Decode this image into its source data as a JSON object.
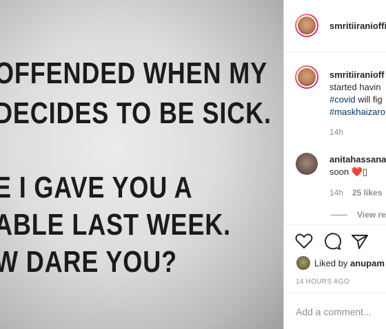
{
  "post_image": {
    "lines": [
      "OFFENDED WHEN MY",
      "DECIDES TO BE SICK.",
      "E I GAVE YOU A",
      "ABLE LAST WEEK.",
      "W DARE YOU?"
    ]
  },
  "header": {
    "username": "smritiiranioffi"
  },
  "caption": {
    "username": "smritiiranioff",
    "line1": "started havin",
    "line2_tag": "#covid",
    "line2_rest": " will fig",
    "line3_tag": "#maskhaizaro",
    "time": "14h"
  },
  "comment": {
    "username": "anitahassana",
    "text": "soon ❤️▯",
    "time": "14h",
    "likes": "25 likes"
  },
  "view_replies": "View re",
  "actions": {
    "like_icon": "heart-icon",
    "comment_icon": "comment-bubble-icon",
    "share_icon": "paper-plane-icon"
  },
  "likes_summary": {
    "prefix": "Liked by ",
    "user": "anupam"
  },
  "timestamp": "14 HOURS AGO",
  "add_comment": {
    "placeholder": "Add a comment..."
  }
}
